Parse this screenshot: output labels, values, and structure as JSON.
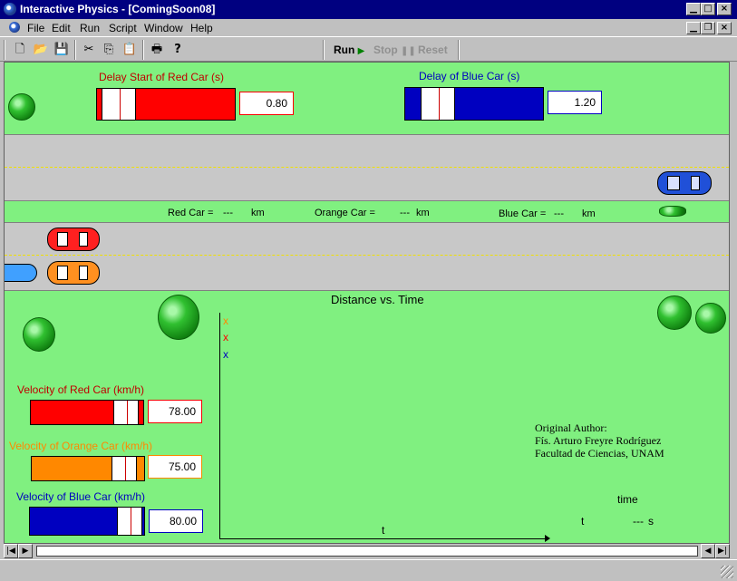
{
  "window": {
    "title": "Interactive Physics - [ComingSoon08]",
    "controls": {
      "minimize": "▁",
      "maximize": "□",
      "close": "×",
      "doc_minimize": "▁",
      "doc_restore": "❐",
      "doc_close": "×"
    }
  },
  "menu": [
    {
      "label": "File"
    },
    {
      "label": "Edit"
    },
    {
      "label": "Run"
    },
    {
      "label": "Script"
    },
    {
      "label": "Window"
    },
    {
      "label": "Help"
    }
  ],
  "toolbar": {
    "icons": [
      "new-file-icon",
      "open-folder-icon",
      "save-icon",
      "cut-icon",
      "copy-icon",
      "paste-icon",
      "print-icon",
      "help-icon"
    ],
    "glyphs": [
      "🗋",
      "📂",
      "💾",
      "✂",
      "⎘",
      "📋",
      "🖶",
      "?"
    ],
    "run_label": "Run",
    "stop_label": "Stop",
    "reset_label": "Reset"
  },
  "colors": {
    "red": "#ff0000",
    "blue": "#0000c0",
    "orange": "#ff8800",
    "grass": "#80f080",
    "road": "#c8c8c8"
  },
  "controls": {
    "delay_red": {
      "label": "Delay Start of Red Car (s)",
      "value": "0.80",
      "fraction": 0.16
    },
    "delay_blue": {
      "label": "Delay of Blue Car (s)",
      "value": "1.20",
      "fraction": 0.24
    },
    "velocity_red": {
      "label": "Velocity of Red Car (km/h)",
      "value": "78.00",
      "fraction": 0.85
    },
    "velocity_orange": {
      "label": "Velocity of Orange Car (km/h)",
      "value": "75.00",
      "fraction": 0.82
    },
    "velocity_blue": {
      "label": "Velocity of Blue Car (km/h)",
      "value": "80.00",
      "fraction": 0.87
    }
  },
  "meters": {
    "red": {
      "label": "Red Car =",
      "value": "---",
      "unit": "km"
    },
    "orange": {
      "label": "Orange Car =",
      "value": "---",
      "unit": "km"
    },
    "blue": {
      "label": "Blue Car =",
      "value": "---",
      "unit": "km"
    }
  },
  "graph": {
    "title": "Distance vs. Time",
    "legend_marks": [
      "x",
      "x",
      "x"
    ],
    "x_label": "t"
  },
  "credits": {
    "line1": "Original Author:",
    "line2": "Fís. Arturo Freyre Rodríguez",
    "line3": "Facultad de Ciencias, UNAM"
  },
  "time_readout": {
    "heading": "time",
    "label": "t",
    "value": "---",
    "unit": "s"
  },
  "scrollbar": {
    "left_arrow": "◀",
    "right_arrow": "▶",
    "end_arrow": "▶"
  }
}
